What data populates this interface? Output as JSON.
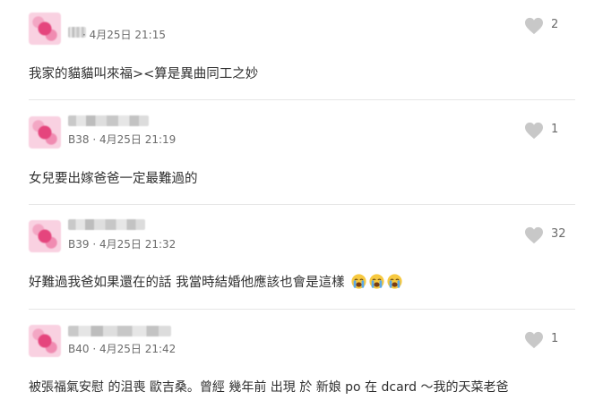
{
  "comments": [
    {
      "floor": "",
      "date": "4月25日 21:15",
      "likes": "2",
      "content": "我家的貓貓叫來福><算是異曲同工之妙"
    },
    {
      "floor": "B38",
      "date": "4月25日 21:19",
      "likes": "1",
      "content": "女兒要出嫁爸爸一定最難過的"
    },
    {
      "floor": "B39",
      "date": "4月25日 21:32",
      "likes": "32",
      "content": "好難過我爸如果還在的話 我當時結婚他應該也會是這樣",
      "emojis": [
        "crying-face",
        "crying-face",
        "crying-face"
      ]
    },
    {
      "floor": "B40",
      "date": "4月25日 21:42",
      "likes": "1",
      "content": "被張福氣安慰 的沮喪 歐吉桑。曾經 幾年前 出現 於 新娘 po 在 dcard ～我的天菜老爸"
    }
  ],
  "separator": "·",
  "colors": {
    "heart": "#c8c8c8",
    "avatar": "#e5457d",
    "divider": "#e6e6e6"
  }
}
